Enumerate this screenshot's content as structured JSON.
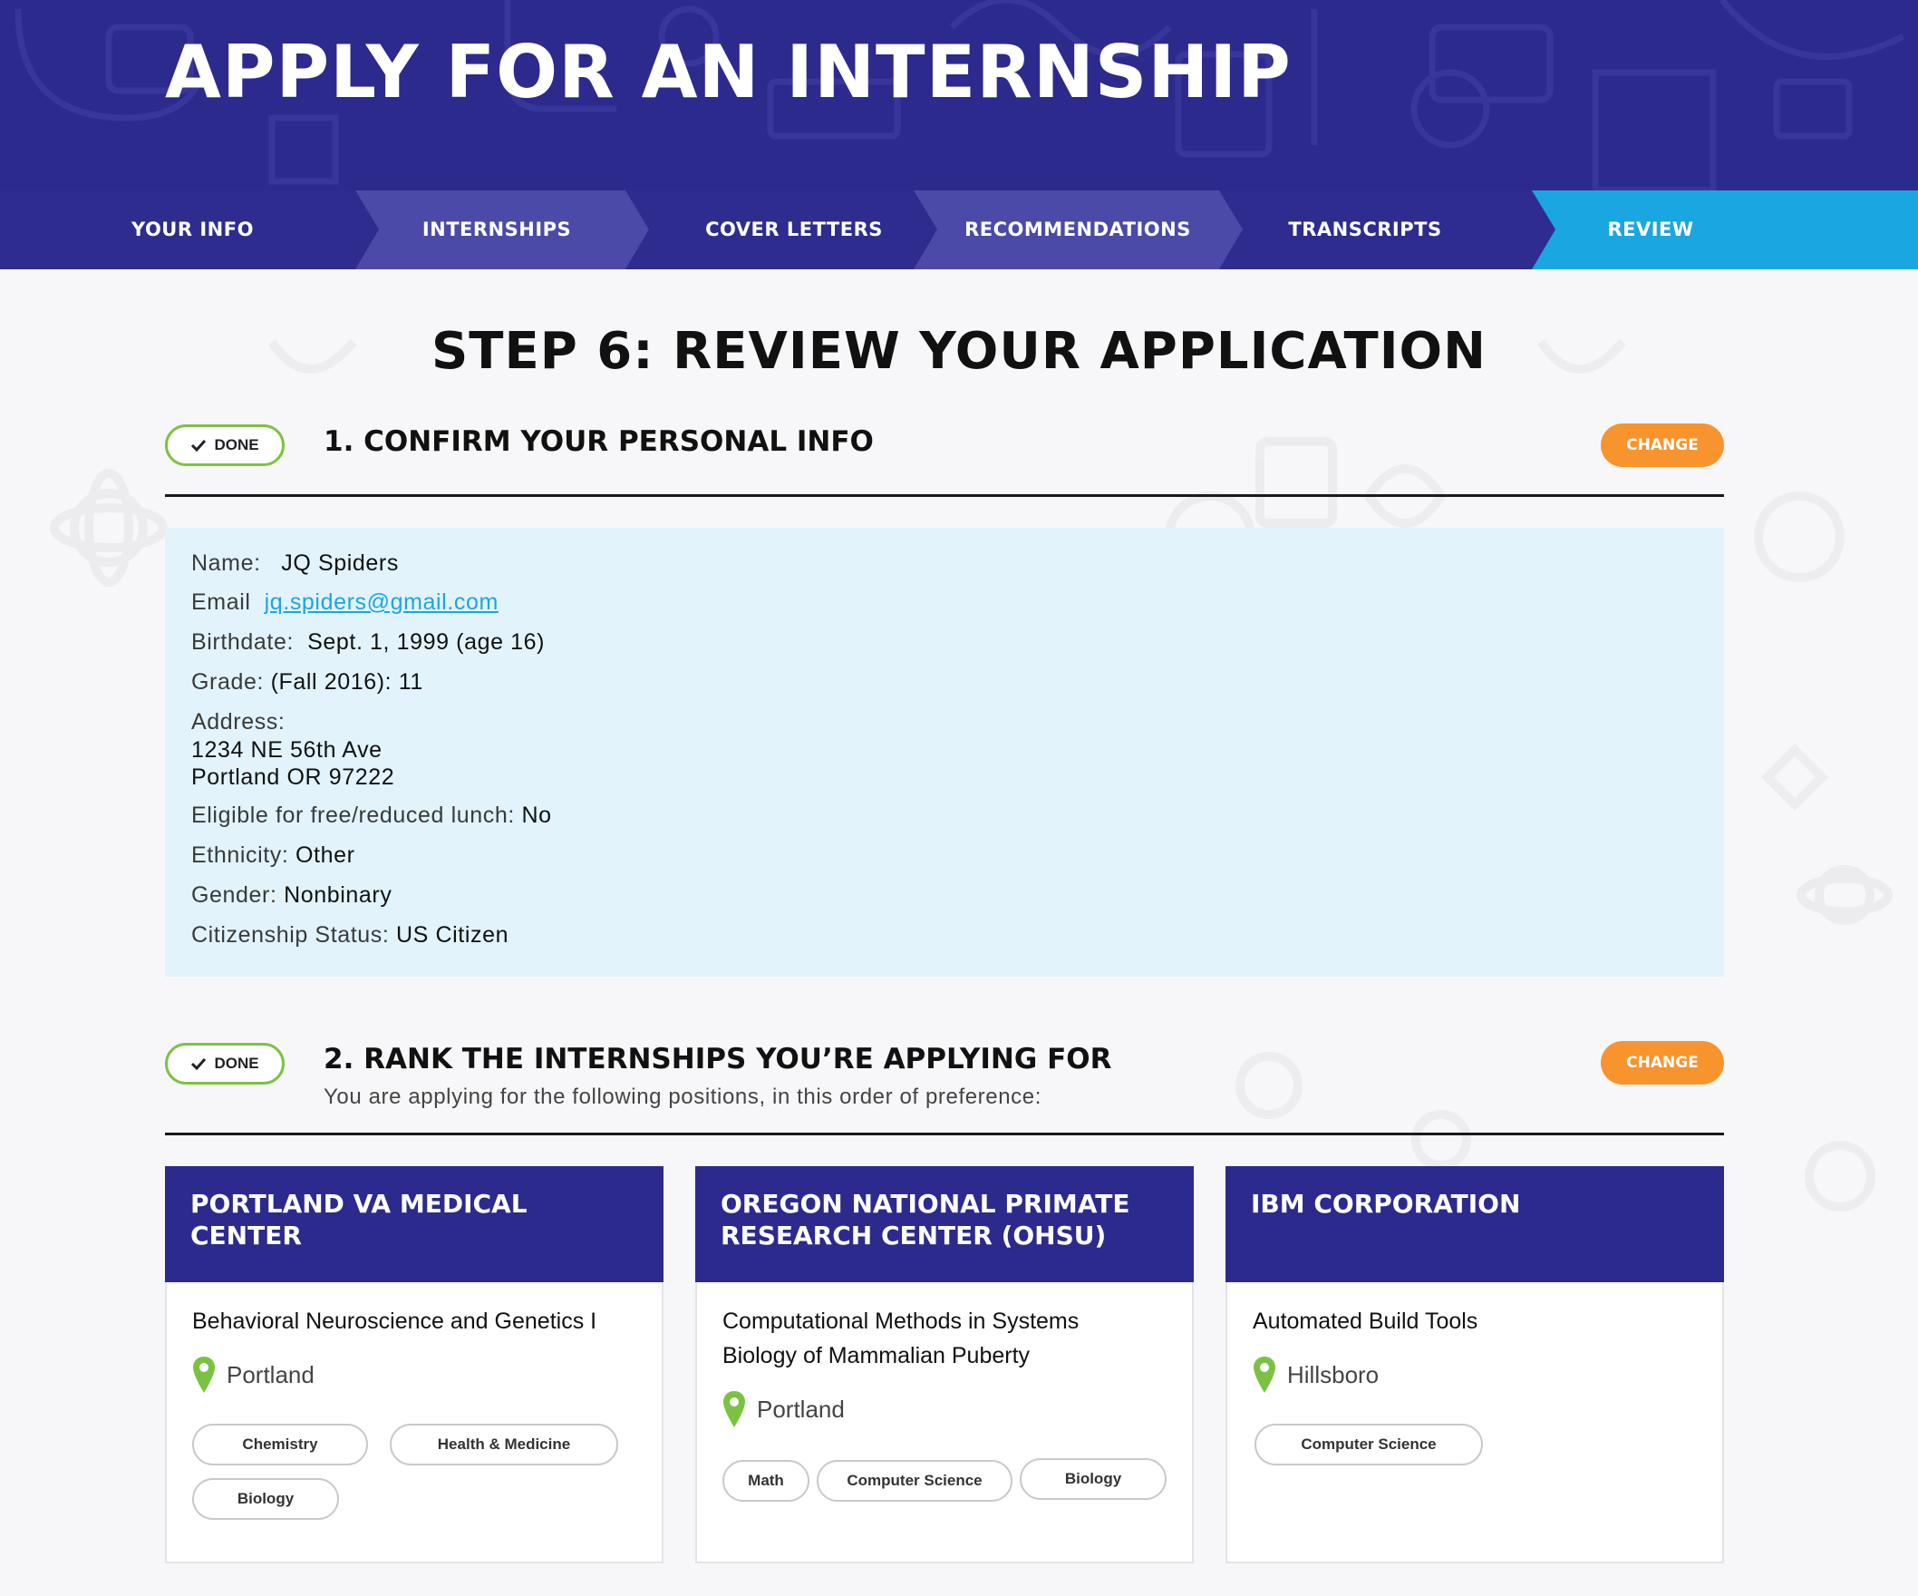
{
  "header": {
    "title": "APPLY FOR AN INTERNSHIP"
  },
  "steps": [
    {
      "label": "YOUR INFO",
      "state": "done"
    },
    {
      "label": "INTERNSHIPS",
      "state": "done"
    },
    {
      "label": "COVER LETTERS",
      "state": "done"
    },
    {
      "label": "RECOMMENDATIONS",
      "state": "done"
    },
    {
      "label": "TRANSCRIPTS",
      "state": "done"
    },
    {
      "label": "REVIEW",
      "state": "active"
    }
  ],
  "page": {
    "heading": "STEP 6: REVIEW YOUR APPLICATION"
  },
  "sections": [
    {
      "badge": "DONE",
      "title": "1. CONFIRM YOUR PERSONAL INFO",
      "change_label": "CHANGE"
    },
    {
      "badge": "DONE",
      "title": "2. RANK THE INTERNSHIPS YOU’RE APPLYING FOR",
      "subtitle": "You are applying for the following positions, in this order of preference:",
      "change_label": "CHANGE"
    }
  ],
  "personal_info": {
    "name_label": "Name:",
    "name": "JQ Spiders",
    "email_label": "Email",
    "email": "jq.spiders@gmail.com",
    "birthdate_label": "Birthdate:",
    "birthdate": "Sept. 1, 1999 (age 16)",
    "grade_label": "Grade:",
    "grade": "(Fall 2016): 11",
    "address_label": "Address:",
    "address_line1": "1234 NE 56th Ave",
    "address_line2": "Portland OR 97222",
    "lunch_label": "Eligible for free/reduced lunch:",
    "lunch": "No",
    "ethnicity_label": "Ethnicity:",
    "ethnicity": "Other",
    "gender_label": "Gender:",
    "gender": "Nonbinary",
    "citizenship_label": "Citizenship Status:",
    "citizenship": "US Citizen"
  },
  "internships": [
    {
      "org": "PORTLAND VA MEDICAL CENTER",
      "title": "Behavioral Neuroscience and Genetics I",
      "location": "Portland",
      "tags": [
        "Chemistry",
        "Health & Medicine",
        "Biology"
      ]
    },
    {
      "org": "OREGON NATIONAL PRIMATE RESEARCH CENTER (OHSU)",
      "title": "Computational Methods in Systems Biology of Mammalian Puberty",
      "location": "Portland",
      "tags": [
        "Math",
        "Computer Science",
        "Biology"
      ]
    },
    {
      "org": "IBM CORPORATION",
      "title": "Automated Build Tools",
      "location": "Hillsboro",
      "tags": [
        "Computer Science"
      ]
    }
  ],
  "colors": {
    "navy": "#2c2a8d",
    "active_step": "#1aa6e0",
    "done_green": "#7cc242",
    "change_orange": "#f7942e",
    "panel_blue": "#e2f3fb"
  },
  "icons": [
    "check-icon",
    "map-pin-icon"
  ]
}
